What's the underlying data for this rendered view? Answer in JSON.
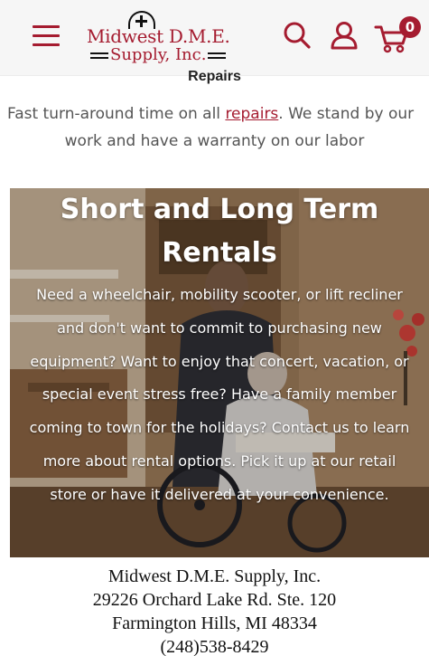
{
  "header": {
    "logo": {
      "line1": "Midwest D.M.E.",
      "line2": "Supply, Inc."
    },
    "cart_count": "0"
  },
  "repairs": {
    "title": "Repairs",
    "text_before_link": "Fast turn-around time on all ",
    "link": "repairs",
    "text_after_link": ". We stand by our",
    "text_line2": "work and have a warranty on our labor"
  },
  "rentals": {
    "title": "Short and Long Term Rentals",
    "body": "Need a wheelchair, mobility scooter, or lift recliner and don't want to commit to purchasing new equipment? Want to enjoy that concert, vacation, or special event stress free? Have a family member coming to town for the holidays? Contact us to learn more about rental options. Pick it up at our retail store or have it delivered at your convenience."
  },
  "footer": {
    "company": "Midwest D.M.E. Supply, Inc.",
    "street": "29226 Orchard Lake Rd. Ste. 120",
    "city": "Farmington Hills, MI 48334",
    "phone": "(248)538-8429"
  },
  "colors": {
    "brand": "#a51c30",
    "header_bg": "#f6f6f6"
  },
  "icons": [
    "menu-icon",
    "search-icon",
    "account-icon",
    "cart-icon"
  ]
}
